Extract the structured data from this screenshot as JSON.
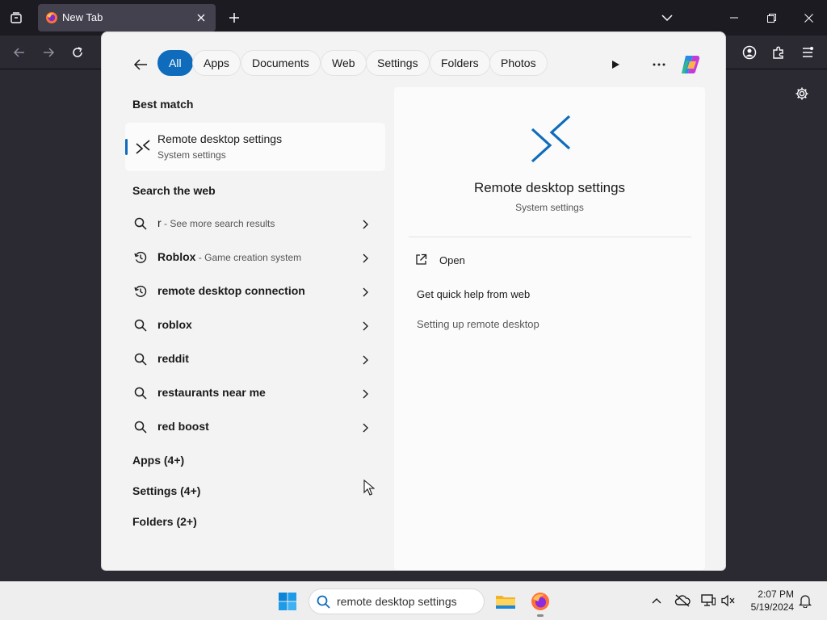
{
  "browser": {
    "tab_title": "New Tab"
  },
  "search_flyout": {
    "filters": [
      "All",
      "Apps",
      "Documents",
      "Web",
      "Settings",
      "Folders",
      "Photos"
    ],
    "active_filter": "All",
    "best_match_heading": "Best match",
    "best_match": {
      "name": "Remote desktop settings",
      "type": "System settings"
    },
    "search_web_heading": "Search the web",
    "web_results": [
      {
        "icon": "search-icon",
        "bold": "r",
        "suffix": " - See more search results"
      },
      {
        "icon": "history-icon",
        "bold": "Roblox",
        "suffix": " - Game creation system"
      },
      {
        "icon": "history-icon",
        "bold": "remote desktop connection",
        "suffix": ""
      },
      {
        "icon": "search-icon",
        "bold": "roblox",
        "suffix": ""
      },
      {
        "icon": "search-icon",
        "bold": "reddit",
        "suffix": ""
      },
      {
        "icon": "search-icon",
        "bold": "restaurants near me",
        "suffix": ""
      },
      {
        "icon": "search-icon",
        "bold": "red boost",
        "suffix": ""
      }
    ],
    "categories": [
      "Apps (4+)",
      "Settings (4+)",
      "Folders (2+)"
    ],
    "preview": {
      "title": "Remote desktop settings",
      "subtitle": "System settings",
      "open_label": "Open",
      "help_heading": "Get quick help from web",
      "help_link": "Setting up remote desktop"
    }
  },
  "taskbar": {
    "search_value": "remote desktop settings",
    "time": "2:07 PM",
    "date": "5/19/2024"
  },
  "colors": {
    "accent": "#0f6cbd",
    "browser_dark": "#1c1b22"
  }
}
